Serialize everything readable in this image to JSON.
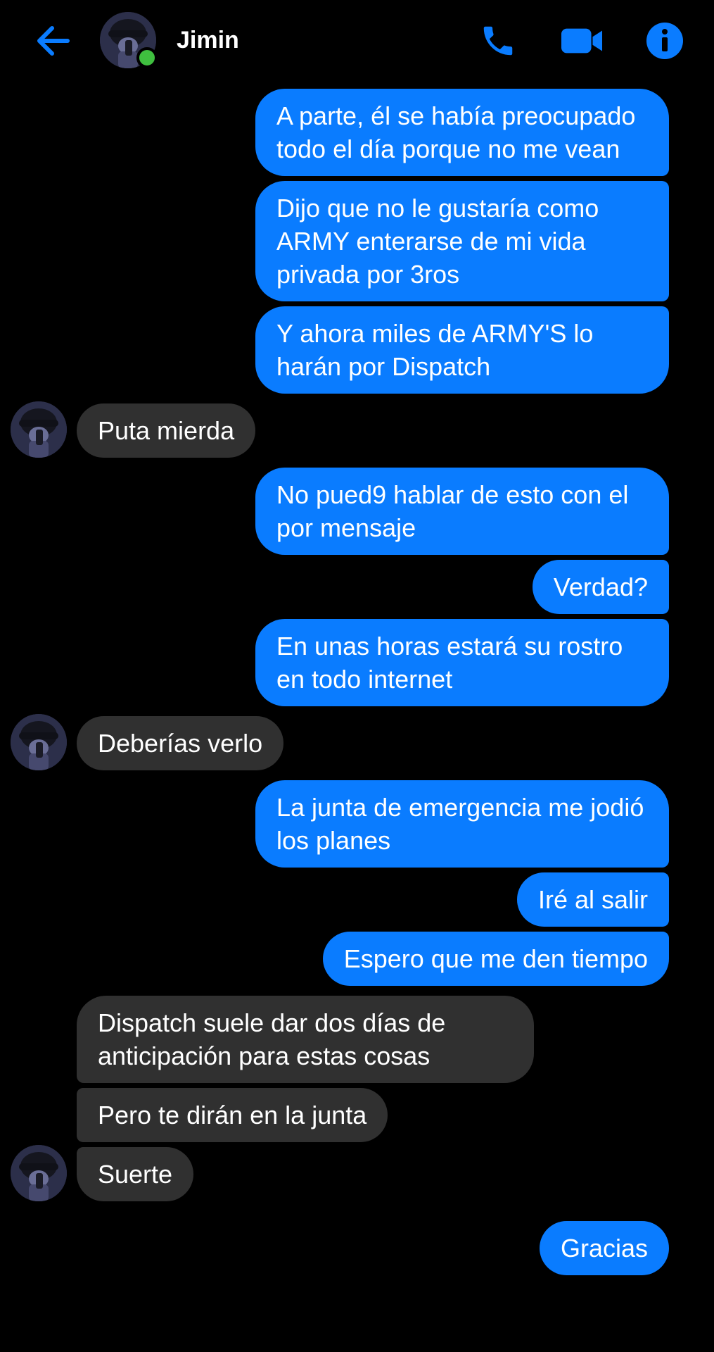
{
  "header": {
    "contact_name": "Jimin",
    "back_icon": "arrow-left-icon",
    "call_icon": "phone-icon",
    "video_icon": "video-camera-icon",
    "info_icon": "info-icon",
    "accent_color": "#0a7cff",
    "online_color": "#3fbf3f"
  },
  "messages": [
    {
      "side": "out",
      "text": "A parte, él se había preocupado todo el día porque no me vean"
    },
    {
      "side": "out",
      "text": "Dijo que no le gustaría como ARMY enterarse de mi vida privada por 3ros"
    },
    {
      "side": "out",
      "text": "Y ahora miles de ARMY'S lo harán por Dispatch"
    },
    {
      "side": "in",
      "text": "Puta mierda"
    },
    {
      "side": "out",
      "text": "No pued9 hablar de esto con el por mensaje"
    },
    {
      "side": "out",
      "text": "Verdad?"
    },
    {
      "side": "out",
      "text": "En unas horas estará su rostro en todo internet"
    },
    {
      "side": "in",
      "text": "Deberías verlo"
    },
    {
      "side": "out",
      "text": "La junta de emergencia me jodió los planes"
    },
    {
      "side": "out",
      "text": "Iré al salir"
    },
    {
      "side": "out",
      "text": "Espero que me den tiempo"
    },
    {
      "side": "in",
      "text": "Dispatch suele dar dos días de anticipación para estas cosas"
    },
    {
      "side": "in",
      "text": "Pero te dirán en la junta"
    },
    {
      "side": "in",
      "text": "Suerte"
    },
    {
      "side": "out",
      "text": "Gracias"
    }
  ],
  "colors": {
    "outgoing_bubble": "#0a7cff",
    "incoming_bubble": "#303030",
    "background": "#000000"
  }
}
